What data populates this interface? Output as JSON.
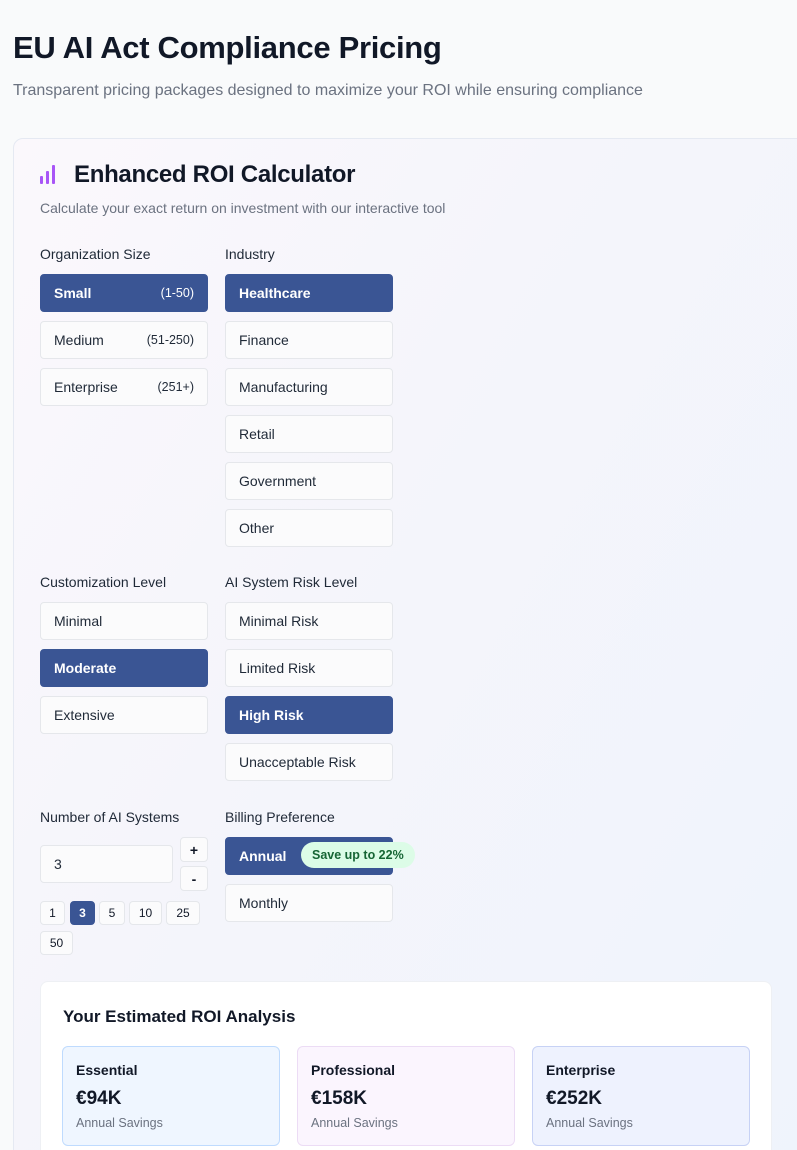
{
  "header": {
    "title": "EU AI Act Compliance Pricing",
    "subtitle": "Transparent pricing packages designed to maximize your ROI while ensuring compliance"
  },
  "calculator": {
    "icon": "bar-chart-icon",
    "title": "Enhanced ROI Calculator",
    "description": "Calculate your exact return on investment with our interactive tool",
    "organization_size": {
      "label": "Organization Size",
      "options": [
        {
          "label": "Small",
          "range": "(1-50)",
          "selected": true
        },
        {
          "label": "Medium",
          "range": "(51-250)",
          "selected": false
        },
        {
          "label": "Enterprise",
          "range": "(251+)",
          "selected": false
        }
      ]
    },
    "industry": {
      "label": "Industry",
      "options": [
        {
          "label": "Healthcare",
          "selected": true
        },
        {
          "label": "Finance",
          "selected": false
        },
        {
          "label": "Manufacturing",
          "selected": false
        },
        {
          "label": "Retail",
          "selected": false
        },
        {
          "label": "Government",
          "selected": false
        },
        {
          "label": "Other",
          "selected": false
        }
      ]
    },
    "customization": {
      "label": "Customization Level",
      "options": [
        {
          "label": "Minimal",
          "selected": false
        },
        {
          "label": "Moderate",
          "selected": true
        },
        {
          "label": "Extensive",
          "selected": false
        }
      ]
    },
    "risk": {
      "label": "AI System Risk Level",
      "options": [
        {
          "label": "Minimal Risk",
          "selected": false
        },
        {
          "label": "Limited Risk",
          "selected": false
        },
        {
          "label": "High Risk",
          "selected": true
        },
        {
          "label": "Unacceptable Risk",
          "selected": false
        }
      ]
    },
    "systems": {
      "label": "Number of AI Systems",
      "value": "3",
      "increment": "+",
      "decrement": "-",
      "presets": [
        {
          "label": "1",
          "selected": false
        },
        {
          "label": "3",
          "selected": true
        },
        {
          "label": "5",
          "selected": false
        },
        {
          "label": "10",
          "selected": false
        },
        {
          "label": "25",
          "selected": false
        },
        {
          "label": "50",
          "selected": false
        }
      ]
    },
    "billing": {
      "label": "Billing Preference",
      "options": [
        {
          "label": "Annual",
          "selected": true
        },
        {
          "label": "Monthly",
          "selected": false
        }
      ],
      "badge": "Save up to 22%"
    }
  },
  "roi": {
    "title": "Your Estimated ROI Analysis",
    "tiers": [
      {
        "name": "Essential",
        "value": "€94K",
        "caption": "Annual Savings",
        "bg": "#eff6ff",
        "border": "#bfdbfe"
      },
      {
        "name": "Professional",
        "value": "€158K",
        "caption": "Annual Savings",
        "bg": "#fbf5fe",
        "border": "#ecdcf5"
      },
      {
        "name": "Enterprise",
        "value": "€252K",
        "caption": "Annual Savings",
        "bg": "#eef2fe",
        "border": "#c7d2f5"
      }
    ]
  },
  "colors": {
    "accent": "#3a5594",
    "icon": "#a855f7",
    "badge_bg": "#dcfce7",
    "badge_text": "#166534"
  }
}
